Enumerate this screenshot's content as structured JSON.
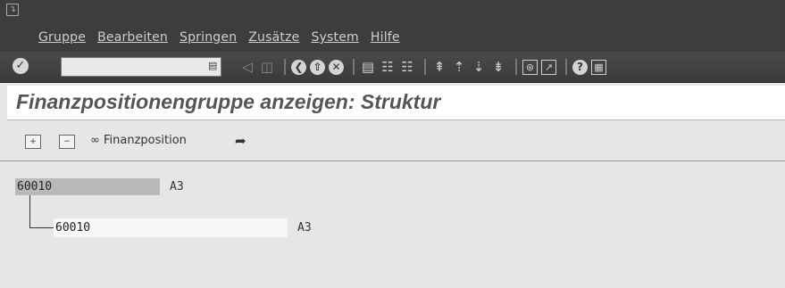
{
  "menubar": {
    "items": [
      "Gruppe",
      "Bearbeiten",
      "Springen",
      "Zusätze",
      "System",
      "Hilfe"
    ]
  },
  "toolbar": {
    "command_field": ""
  },
  "title": "Finanzpositionengruppe anzeigen: Struktur",
  "app_toolbar": {
    "finanzposition_label": "Finanzposition"
  },
  "tree": {
    "root": {
      "key": "60010",
      "value": "A3"
    },
    "children": [
      {
        "key": "60010",
        "value": "A3"
      }
    ]
  }
}
